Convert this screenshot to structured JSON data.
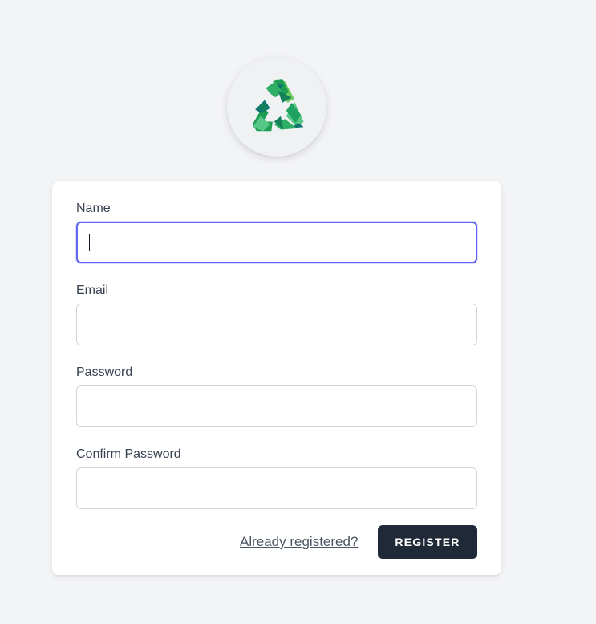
{
  "logo": {
    "icon": "recycle-icon",
    "colors": [
      "#1f9d55",
      "#2ecc71",
      "#0f766e",
      "#57c785"
    ]
  },
  "form": {
    "fields": [
      {
        "label": "Name",
        "value": "",
        "focused": true
      },
      {
        "label": "Email",
        "value": ""
      },
      {
        "label": "Password",
        "value": ""
      },
      {
        "label": "Confirm Password",
        "value": ""
      }
    ],
    "login_link": "Already registered?",
    "register_label": "REGISTER"
  },
  "colors": {
    "background": "#f3f4f6",
    "focus_ring": "#6366f1",
    "button": "#1f2937"
  }
}
